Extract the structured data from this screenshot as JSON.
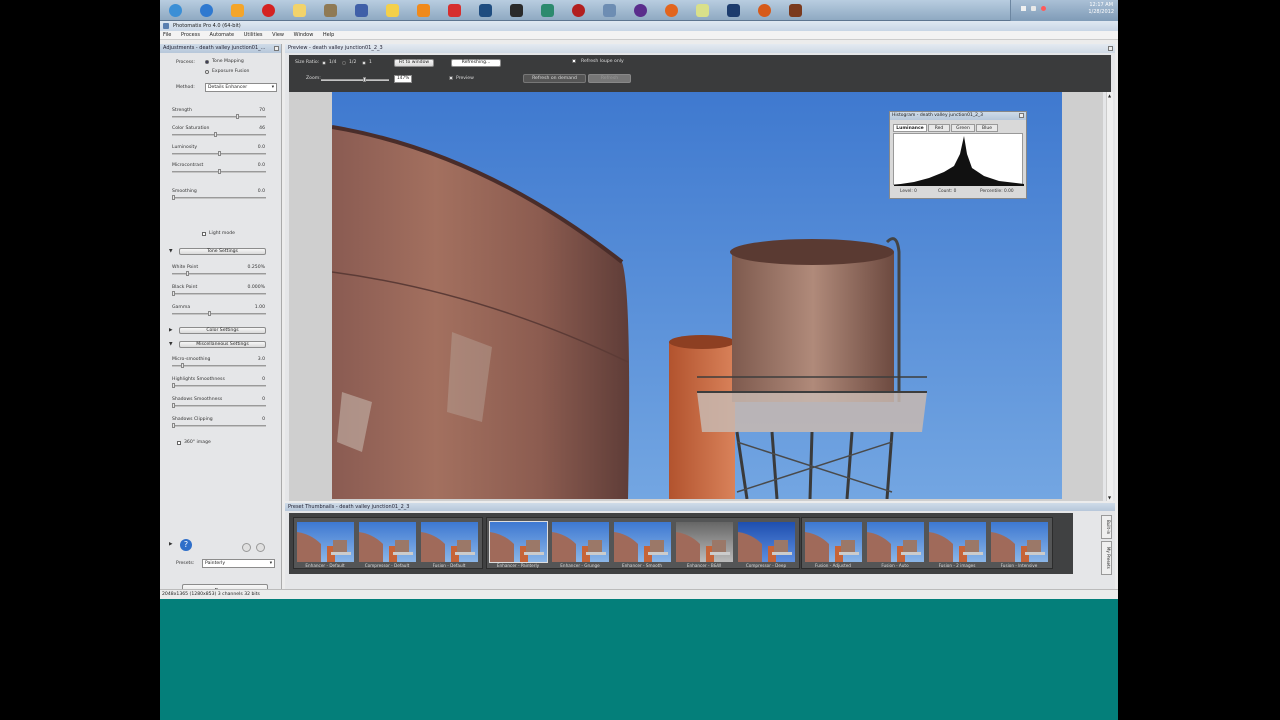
{
  "taskbar": {
    "icons": [
      {
        "name": "start-orb-icon",
        "color": "#3b8fd6"
      },
      {
        "name": "internet-explorer-icon",
        "color": "#2f79d0"
      },
      {
        "name": "media-player-icon",
        "color": "#f4a52a"
      },
      {
        "name": "opera-icon",
        "color": "#d42222"
      },
      {
        "name": "file-explorer-icon",
        "color": "#f2d36b"
      },
      {
        "name": "gimp-icon",
        "color": "#8f7a55"
      },
      {
        "name": "document-icon",
        "color": "#3f5fa8"
      },
      {
        "name": "sticky-notes-icon",
        "color": "#f4d04a"
      },
      {
        "name": "blender-icon",
        "color": "#f08a1c"
      },
      {
        "name": "star-app-icon",
        "color": "#d62e2e"
      },
      {
        "name": "image-viewer-icon",
        "color": "#1f4d80"
      },
      {
        "name": "graph-app-icon",
        "color": "#2a2a2a"
      },
      {
        "name": "camera-app-icon",
        "color": "#2c8a6e"
      },
      {
        "name": "close-app-icon",
        "color": "#b21f1f"
      },
      {
        "name": "photomatix-icon",
        "color": "#6d8db3"
      },
      {
        "name": "eclipse-icon",
        "color": "#5a2d8c"
      },
      {
        "name": "firefox-icon",
        "color": "#e2651e"
      },
      {
        "name": "notes-icon",
        "color": "#d9e08a"
      },
      {
        "name": "photoshop-icon",
        "color": "#1c3c6e"
      },
      {
        "name": "firefox-alt-icon",
        "color": "#d65a1a"
      },
      {
        "name": "media-app-icon",
        "color": "#7a3a1e"
      }
    ],
    "clock_time": "12:17 AM",
    "clock_date": "1/28/2012"
  },
  "app": {
    "title": "Photomatix Pro 4.0 (64-bit)",
    "menu": [
      "File",
      "Process",
      "Automate",
      "Utilities",
      "View",
      "Window",
      "Help"
    ]
  },
  "adjustments": {
    "header": "Adjustments - death valley junction01_...",
    "process_label": "Process:",
    "process_options": [
      "Tone Mapping",
      "Exposure Fusion"
    ],
    "method_label": "Method:",
    "method_value": "Details Enhancer",
    "sliders": [
      {
        "label": "Strength",
        "value": "70",
        "level": 0.7
      },
      {
        "label": "Color Saturation",
        "value": "46",
        "level": 0.46
      },
      {
        "label": "Luminosity",
        "value": "0.0",
        "level": 0.5
      },
      {
        "label": "Microcontrast",
        "value": "0.0",
        "level": 0.5
      },
      {
        "label": "Smoothing",
        "value": "0.0",
        "level": 0.0
      }
    ],
    "light_mode_label": "Light mode",
    "tone_settings_label": "Tone Settings",
    "tone_sliders": [
      {
        "label": "White Point",
        "value": "0.250%",
        "level": 0.15
      },
      {
        "label": "Black Point",
        "value": "0.000%",
        "level": 0.0
      },
      {
        "label": "Gamma",
        "value": "1.00",
        "level": 0.4
      }
    ],
    "color_settings_label": "Color Settings",
    "misc_settings_label": "Miscellaneous Settings",
    "misc_sliders": [
      {
        "label": "Micro-smoothing",
        "value": "3.0",
        "level": 0.1
      },
      {
        "label": "Highlights Smoothness",
        "value": "0",
        "level": 0.0
      },
      {
        "label": "Shadows Smoothness",
        "value": "0",
        "level": 0.0
      },
      {
        "label": "Shadows Clipping",
        "value": "0",
        "level": 0.0
      }
    ],
    "image360_label": "360° image",
    "presets_label": "Presets:",
    "presets_value": "Painterly",
    "process_button": "Process"
  },
  "preview": {
    "header": "Preview - death valley junction01_2_3",
    "size_ratio_label": "Size Ratio:",
    "size_ratio_options": [
      "1/4",
      "1/2",
      "1"
    ],
    "fit_button": "Fit to window",
    "refreshing_label": "Refreshing...",
    "refresh_loupe_label": "Refresh loupe only",
    "zoom_label": "Zoom:",
    "zoom_value": "147%",
    "preview_label": "Preview",
    "refresh_on_demand_label": "Refresh on demand",
    "refresh_button": "Refresh"
  },
  "histogram": {
    "header": "Histogram - death valley junction01_2_3",
    "tabs": [
      "Luminance",
      "Red",
      "Green",
      "Blue"
    ],
    "level_label": "Level: 0",
    "count_label": "Count: 0",
    "percentile_label": "Percentile: 0.00"
  },
  "thumbnails": {
    "header": "Preset Thumbnails - death valley junction01_2_3",
    "group1": [
      "Enhancer - Default",
      "Compressor - Default",
      "Fusion - Default"
    ],
    "group2": [
      "Enhancer - Painterly",
      "Enhancer - Grunge",
      "Enhancer - Smooth",
      "Enhancer - B&W",
      "Compressor - Deep"
    ],
    "group3": [
      "Fusion - Adjusted",
      "Fusion - Auto",
      "Fusion - 2 images",
      "Fusion - Intensive"
    ],
    "side_tabs": [
      "Built-in",
      "My Presets"
    ]
  },
  "status": "2048x1365 (1280x853) 3 channels 32 bits"
}
